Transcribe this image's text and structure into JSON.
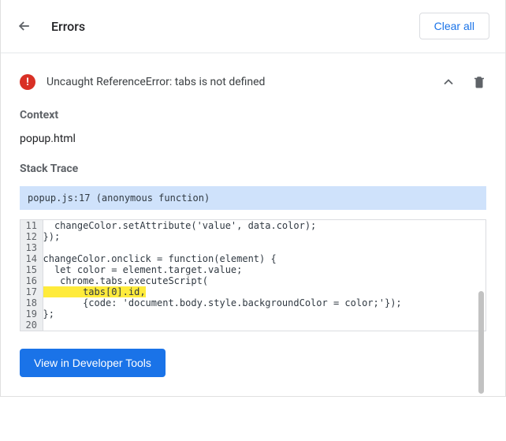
{
  "header": {
    "title": "Errors",
    "clear_label": "Clear all"
  },
  "error": {
    "message": "Uncaught ReferenceError: tabs is not defined"
  },
  "context": {
    "label": "Context",
    "value": "popup.html"
  },
  "stack": {
    "label": "Stack Trace",
    "header": "popup.js:17 (anonymous function)"
  },
  "code": {
    "lines": [
      {
        "num": "11",
        "text": "  changeColor.setAttribute('value', data.color);",
        "hl": false
      },
      {
        "num": "12",
        "text": "});",
        "hl": false
      },
      {
        "num": "13",
        "text": "",
        "hl": false
      },
      {
        "num": "14",
        "text": "changeColor.onclick = function(element) {",
        "hl": false
      },
      {
        "num": "15",
        "text": "  let color = element.target.value;",
        "hl": false
      },
      {
        "num": "16",
        "text": "   chrome.tabs.executeScript(",
        "hl": false
      },
      {
        "num": "17",
        "text": "       tabs[0].id,",
        "hl": true
      },
      {
        "num": "18",
        "text": "       {code: 'document.body.style.backgroundColor = color;'});",
        "hl": false
      },
      {
        "num": "19",
        "text": "};",
        "hl": false
      },
      {
        "num": "20",
        "text": "",
        "hl": false
      }
    ]
  },
  "footer": {
    "dev_tools_label": "View in Developer Tools"
  }
}
